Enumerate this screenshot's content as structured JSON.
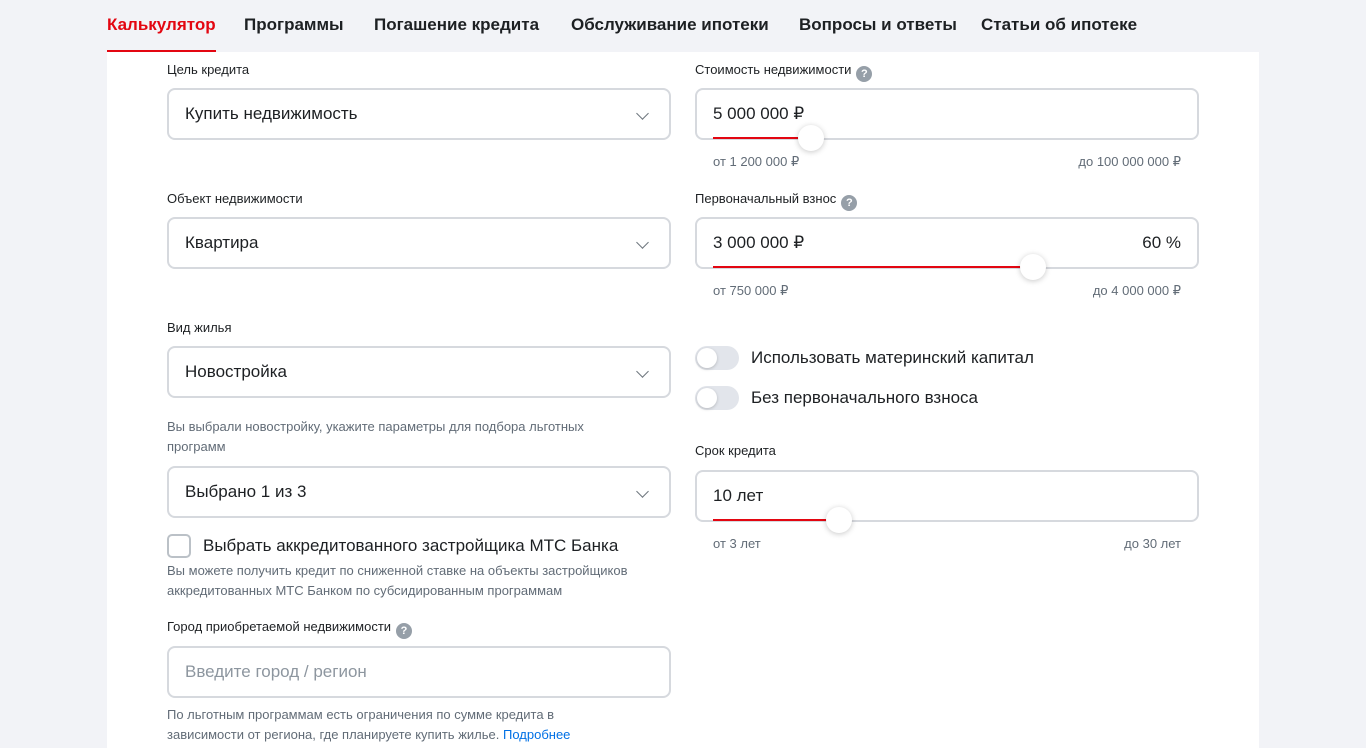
{
  "nav": {
    "tabs": [
      {
        "label": "Калькулятор",
        "active": true
      },
      {
        "label": "Программы"
      },
      {
        "label": "Погашение кредита"
      },
      {
        "label": "Обслуживание ипотеки"
      },
      {
        "label": "Вопросы и ответы"
      },
      {
        "label": "Статьи об ипотеке"
      }
    ]
  },
  "colors": {
    "accent": "#e30611",
    "link": "#0070e5"
  },
  "left": {
    "purpose": {
      "label": "Цель кредита",
      "value": "Купить недвижимость"
    },
    "object": {
      "label": "Объект недвижимости",
      "value": "Квартира"
    },
    "housing": {
      "label": "Вид жилья",
      "value": "Новостройка"
    },
    "programs_hint": "Вы выбрали новостройку, укажите параметры для подбора льготных программ",
    "programs": {
      "value": "Выбрано 1 из 3"
    },
    "accredited": {
      "label": "Выбрать аккредитованного застройщика МТС Банка",
      "checked": false,
      "hint": "Вы можете получить кредит по сниженной ставке на объекты застройщиков аккредитованных МТС Банком по субсидированным программам"
    },
    "city": {
      "label": "Город приобретаемой недвижимости",
      "placeholder": "Введите город / регион",
      "hint": "По льготным программам есть ограничения по сумме кредита в зависимости от региона, где планируете купить жилье.",
      "hint_link": "Подробнее"
    }
  },
  "right": {
    "price": {
      "label": "Стоимость недвижимости",
      "value": "5 000 000 ₽",
      "min": "от 1 200 000 ₽",
      "max": "до 100 000 000 ₽",
      "slider_fraction": 0.2
    },
    "down_payment": {
      "label": "Первоначальный взнос",
      "value": "3 000 000 ₽",
      "percent": "60 %",
      "min": "от 750 000 ₽",
      "max": "до 4 000 000 ₽",
      "slider_fraction": 0.67
    },
    "maternity_capital": {
      "label": "Использовать материнский капитал",
      "on": false
    },
    "no_down_payment": {
      "label": "Без первоначального взноса",
      "on": false
    },
    "term": {
      "label": "Срок кредита",
      "value": "10 лет",
      "min": "от 3 лет",
      "max": "до 30 лет",
      "slider_fraction": 0.26
    }
  },
  "help_icon_glyph": "?"
}
